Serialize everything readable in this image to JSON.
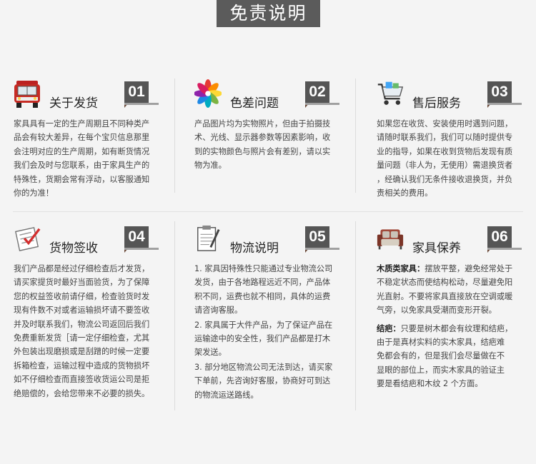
{
  "page": {
    "title": "免责说明"
  },
  "cards": [
    {
      "number": "01",
      "title": "关于发货",
      "icon": "fire-truck-icon",
      "lines": [
        "家具具有一定的生产周期且不同种类产",
        "品会有较大差异，在每个宝贝信息那里",
        "会注明对应的生产周期，如有断货情况",
        "我们会及时与您联系，由于家具生产的",
        "特殊性，货期会常有浮动，以客服通知",
        "你的为准！"
      ]
    },
    {
      "number": "02",
      "title": "色差问题",
      "icon": "color-wheel-icon",
      "lines": [
        "产品图片均为实物照片，但由于拍摄技",
        "术、光线、显示器参数等因素影响，收",
        "到的实物颜色与照片会有差别，请以实",
        "物为准。"
      ]
    },
    {
      "number": "03",
      "title": "售后服务",
      "icon": "shopping-cart-icon",
      "lines": [
        "如果您在收货、安装使用时遇到问题，",
        "请随时联系我们，我们可以随时提供专",
        "业的指导，如果在收到货物后发现有质",
        "量问题（非人为，无使用）需退换货者",
        "，经确认我们无条件接收退换货，并负",
        "责相关的费用。"
      ]
    },
    {
      "number": "04",
      "title": "货物签收",
      "icon": "checklist-icon",
      "lines": [
        "我们产品都是经过仔细检查后才发货，",
        "请买家提货时最好当面验货，为了保障",
        "您的权益签收前请仔细，检查验货时发",
        "现有件数不对或者运输损坏请不要签收",
        "并及时联系我们，物流公司返回后我们",
        "免费重新发货［请一定仔细检查，尤其",
        "外包装出现磨损或是刮蹭的时候一定要",
        "拆箱检查，运输过程中造成的货物损坏",
        "如不仔细检查而直接签收货运公司是拒",
        "绝赔偿的，会给您带来不必要的损失。"
      ]
    },
    {
      "number": "05",
      "title": "物流说明",
      "icon": "clipboard-pen-icon",
      "paras": [
        [
          "1. 家具因特殊性只能通过专业物流公司",
          "发货，由于各地路程远近不同，产品体",
          "积不同，运费也就不相同，具体的运费",
          "请咨询客服。"
        ],
        [
          "2. 家具属于大件产品，为了保证产品在",
          "运输途中的安全性，我们产品都是打木",
          "架发送。"
        ],
        [
          "3. 部分地区物流公司无法到达，请买家",
          "下单前，先咨询好客服，协商好可到达",
          "的物流运送路线。"
        ]
      ]
    },
    {
      "number": "06",
      "title": "家具保养",
      "icon": "sofa-icon",
      "section1": {
        "label": "木质类家具：",
        "lines": [
          "摆放平整，避免经常处于",
          "不稳定状态而使结构松动，尽量避免阳",
          "光直射。不要将家具直接放在空调或暖",
          "气旁，以免家具受潮而变形开裂。"
        ]
      },
      "section2": {
        "label": "结疤：",
        "lines": [
          "只要是树木都会有纹理和结疤，",
          "由于是真材实料的实木家具，结疤难",
          "免都会有的，但是我们会尽量做在不",
          "显眼的部位上，而实木家具的验证主",
          "要是看结疤和木纹 2 个方面。"
        ]
      }
    }
  ]
}
